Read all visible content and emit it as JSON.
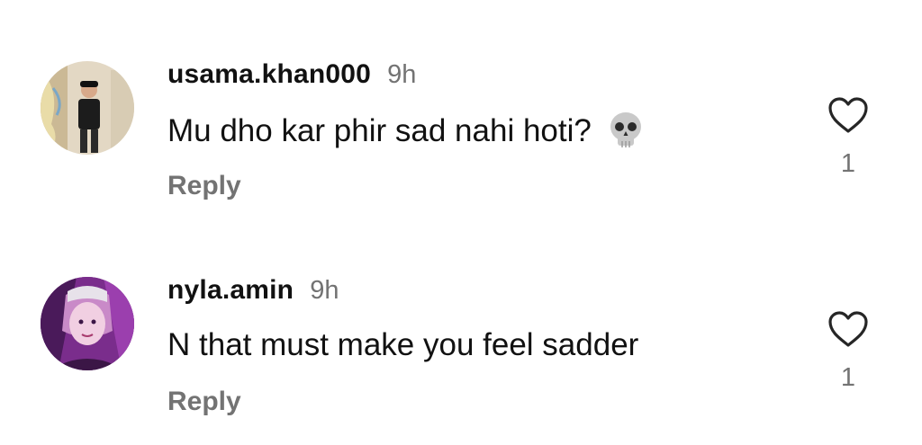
{
  "comments": [
    {
      "username": "usama.khan000",
      "time": "9h",
      "text": "Mu dho kar phir sad nahi hoti?",
      "emoji": "skull-icon",
      "reply_label": "Reply",
      "likes": "1",
      "avatar_palette": [
        "#d9cdb8",
        "#222222",
        "#e8d9a0",
        "#c8b48c"
      ]
    },
    {
      "username": "nyla.amin",
      "time": "9h",
      "text": "N that must make you feel sadder",
      "emoji": "",
      "reply_label": "Reply",
      "likes": "1",
      "avatar_palette": [
        "#7a2d8c",
        "#e9a8d8",
        "#3b1646",
        "#f4d6e6"
      ]
    }
  ],
  "colors": {
    "primary_text": "#111111",
    "secondary_text": "#737373",
    "background": "#ffffff"
  }
}
